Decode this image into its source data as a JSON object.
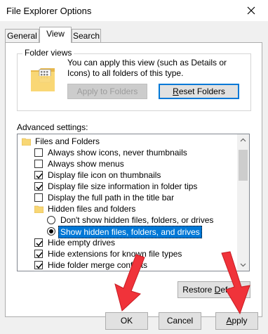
{
  "window": {
    "title": "File Explorer Options"
  },
  "tabs": [
    {
      "label": "General"
    },
    {
      "label": "View"
    },
    {
      "label": "Search"
    }
  ],
  "folder_views": {
    "title": "Folder views",
    "description": "You can apply this view (such as Details or Icons) to all folders of this type.",
    "apply_button": "Apply to Folders",
    "reset_button_pre": "",
    "reset_button_ul": "R",
    "reset_button_post": "eset Folders"
  },
  "advanced": {
    "label": "Advanced settings:",
    "items": [
      {
        "type": "folder",
        "label": "Files and Folders"
      },
      {
        "type": "checkbox",
        "label": "Always show icons, never thumbnails",
        "checked": false
      },
      {
        "type": "checkbox",
        "label": "Always show menus",
        "checked": false
      },
      {
        "type": "checkbox",
        "label": "Display file icon on thumbnails",
        "checked": true
      },
      {
        "type": "checkbox",
        "label": "Display file size information in folder tips",
        "checked": true
      },
      {
        "type": "checkbox",
        "label": "Display the full path in the title bar",
        "checked": false
      },
      {
        "type": "folder",
        "label": "Hidden files and folders"
      },
      {
        "type": "radio",
        "label": "Don't show hidden files, folders, or drives",
        "checked": false
      },
      {
        "type": "radio",
        "label": "Show hidden files, folders, and drives",
        "checked": true
      },
      {
        "type": "checkbox",
        "label": "Hide empty drives",
        "checked": true
      },
      {
        "type": "checkbox",
        "label": "Hide extensions for known file types",
        "checked": true
      },
      {
        "type": "checkbox",
        "label": "Hide folder merge conflicts",
        "checked": true
      }
    ]
  },
  "buttons": {
    "restore_pre": "Restore ",
    "restore_ul": "D",
    "restore_post": "efaults",
    "ok": "OK",
    "cancel": "Cancel",
    "apply_ul": "A",
    "apply_post": "pply"
  },
  "colors": {
    "accent": "#0078d7",
    "arrow": "#f0333a",
    "folder": "#f8d775"
  }
}
